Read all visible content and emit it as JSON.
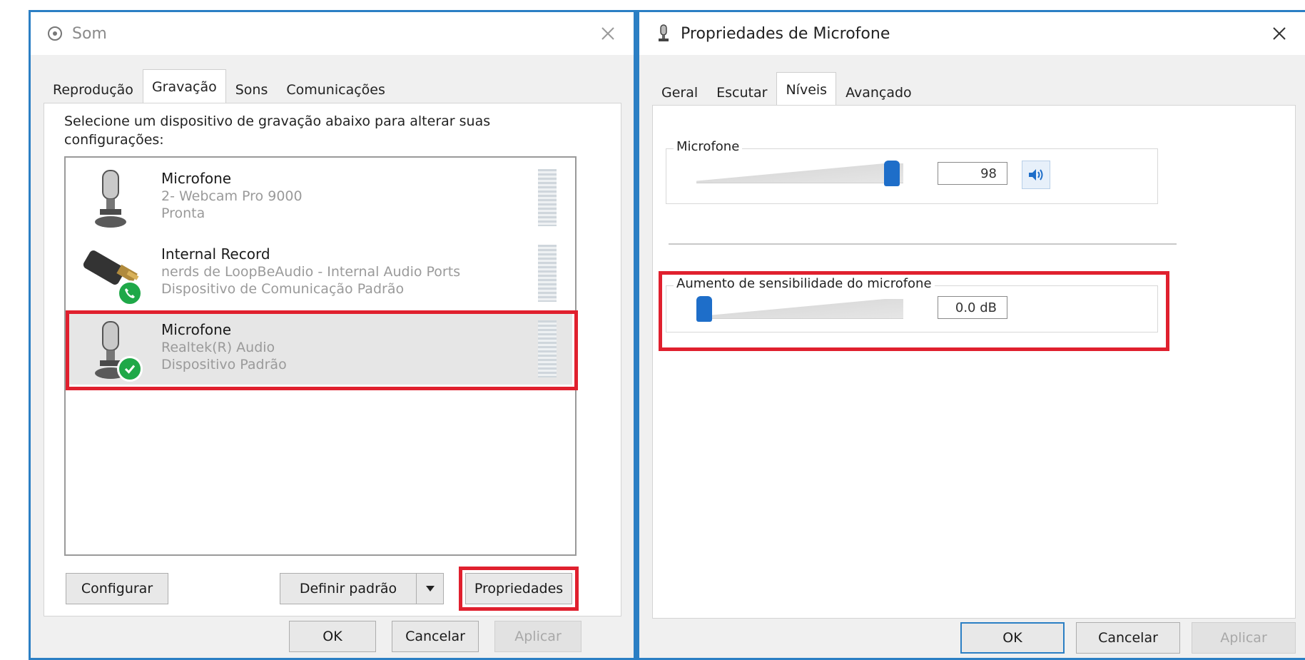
{
  "left_window": {
    "title": "Som",
    "tabs": [
      {
        "label": "Reprodução",
        "active": false
      },
      {
        "label": "Gravação",
        "active": true
      },
      {
        "label": "Sons",
        "active": false
      },
      {
        "label": "Comunicações",
        "active": false
      }
    ],
    "instruction": "Selecione um dispositivo de gravação abaixo para alterar suas configurações:",
    "devices": [
      {
        "name": "Microfone",
        "detail": "2- Webcam Pro 9000",
        "status": "Pronta",
        "icon": "microphone-icon",
        "badge": ""
      },
      {
        "name": "Internal Record",
        "detail": "nerds de LoopBeAudio - Internal Audio Ports",
        "status": "Dispositivo de Comunicação Padrão",
        "icon": "audio-cable-icon",
        "badge": "phone-badge-icon"
      },
      {
        "name": "Microfone",
        "detail": "Realtek(R) Audio",
        "status": "Dispositivo Padrão",
        "icon": "microphone-icon",
        "badge": "check-badge-icon",
        "selected": true
      }
    ],
    "buttons": {
      "configure": "Configurar",
      "set_default": "Definir padrão",
      "properties": "Propriedades",
      "ok": "OK",
      "cancel": "Cancelar",
      "apply": "Aplicar"
    }
  },
  "right_window": {
    "title": "Propriedades de Microfone",
    "tabs": [
      {
        "label": "Geral",
        "active": false
      },
      {
        "label": "Escutar",
        "active": false
      },
      {
        "label": "Níveis",
        "active": true
      },
      {
        "label": "Avançado",
        "active": false
      }
    ],
    "microphone_group": {
      "label": "Microfone",
      "value": "98",
      "level_fraction": 0.98
    },
    "boost_group": {
      "label": "Aumento de sensibilidade do microfone",
      "value": "0.0 dB",
      "level_fraction": 0.0
    },
    "buttons": {
      "ok": "OK",
      "cancel": "Cancelar",
      "apply": "Aplicar"
    }
  },
  "colors": {
    "accent": "#2b7fc4",
    "highlight": "#e0202e",
    "status_green": "#1fa848",
    "slider_thumb": "#1e6ec9"
  }
}
